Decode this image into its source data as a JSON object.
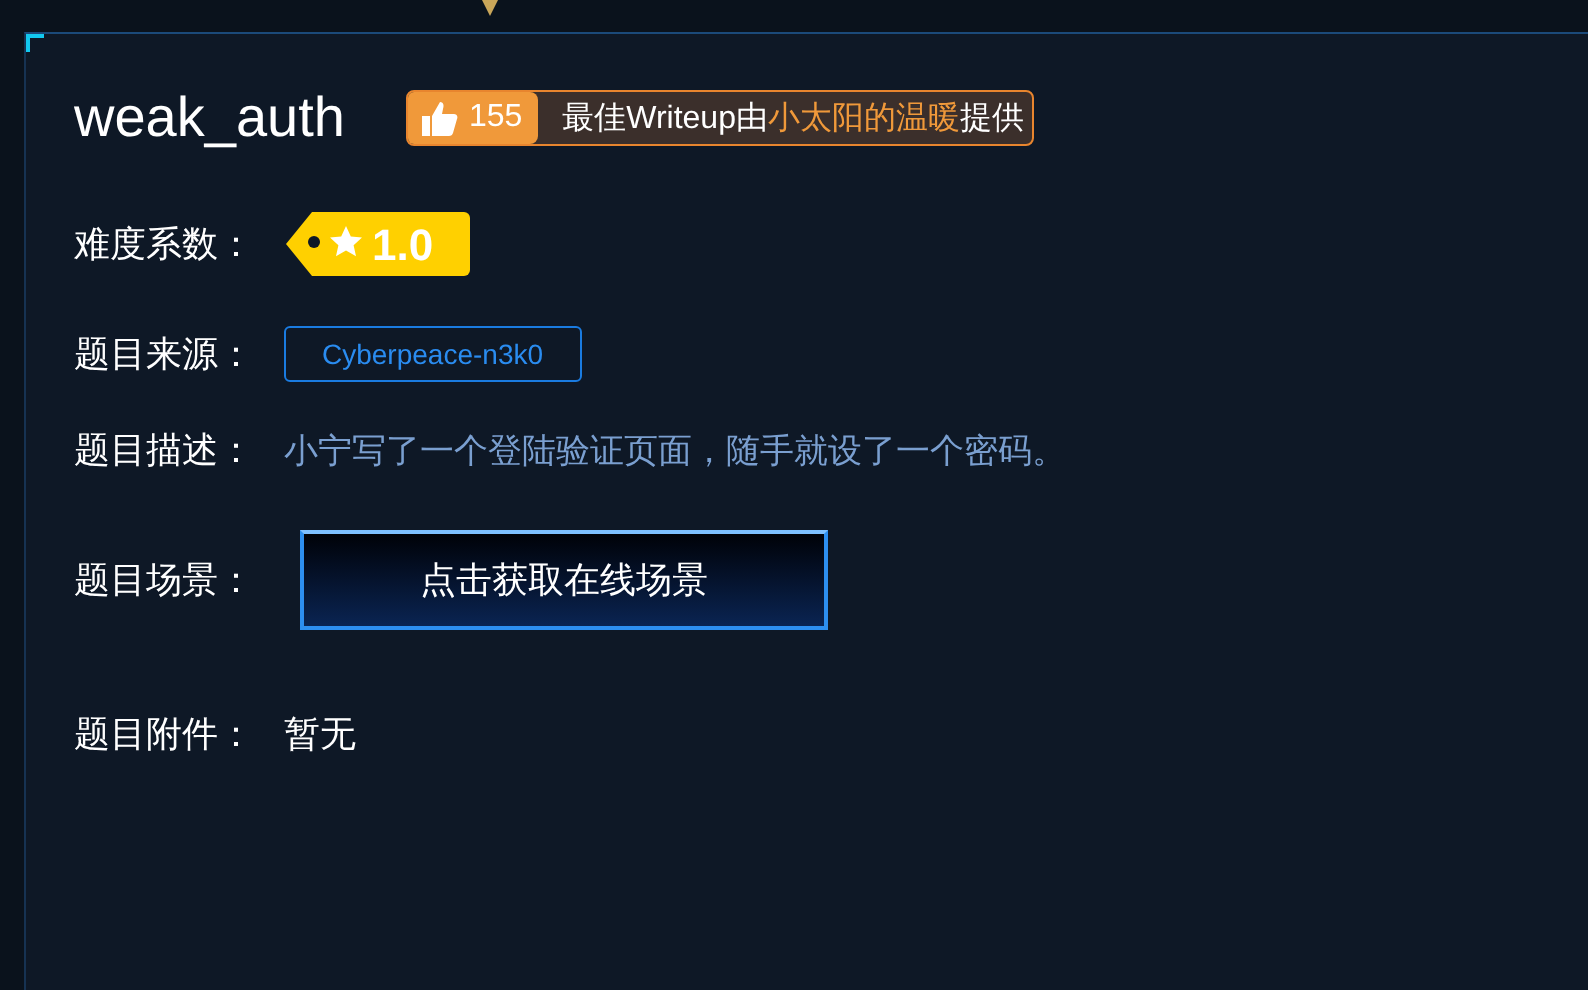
{
  "challenge": {
    "title": "weak_auth",
    "likes": "155",
    "credit": {
      "before": "最佳Writeup由",
      "author": "小太阳的温暖",
      "after": "提供"
    }
  },
  "fields": [
    {
      "kind": "difficulty",
      "label": "难度系数：",
      "value": "1.0"
    },
    {
      "kind": "source",
      "label": "题目来源：",
      "value": "Cyberpeace-n3k0"
    },
    {
      "kind": "description",
      "label": "题目描述：",
      "value": "小宁写了一个登陆验证页面，随手就设了一个密码。"
    },
    {
      "kind": "scene",
      "label": "题目场景：",
      "value": "点击获取在线场景"
    },
    {
      "kind": "attachment",
      "label": "题目附件：",
      "value": "暂无"
    }
  ]
}
